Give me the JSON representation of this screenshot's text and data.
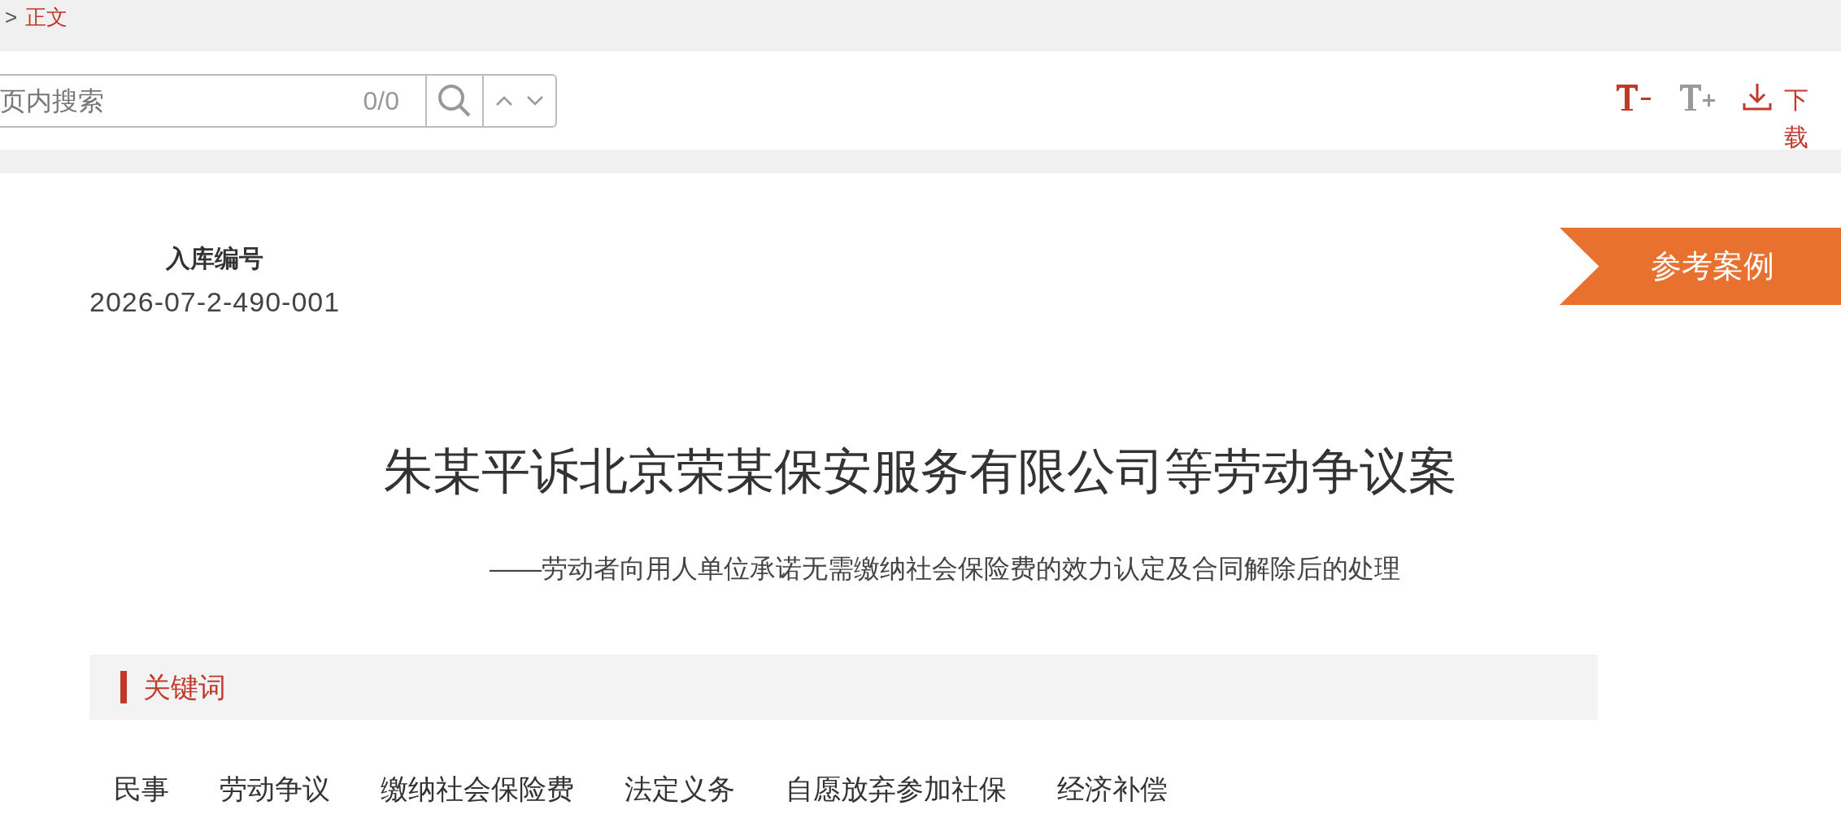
{
  "breadcrumb": {
    "separator": ">",
    "current": "正文"
  },
  "search": {
    "placeholder": "页内搜索",
    "count": "0/0"
  },
  "toolbar": [
    {
      "kind": "font_smaller",
      "enabled": true
    },
    {
      "kind": "font_larger",
      "enabled": false
    },
    {
      "kind": "download",
      "label": "下载"
    }
  ],
  "case": {
    "id_label": "入库编号",
    "id": "2026-07-2-490-001",
    "badge": "参考案例",
    "title": "朱某平诉北京荣某保安服务有限公司等劳动争议案",
    "subtitle": "——劳动者向用人单位承诺无需缴纳社会保险费的效力认定及合同解除后的处理"
  },
  "keywords": {
    "heading": "关键词",
    "items": [
      "民事",
      "劳动争议",
      "缴纳社会保险费",
      "法定义务",
      "自愿放弃参加社保",
      "经济补偿"
    ]
  }
}
